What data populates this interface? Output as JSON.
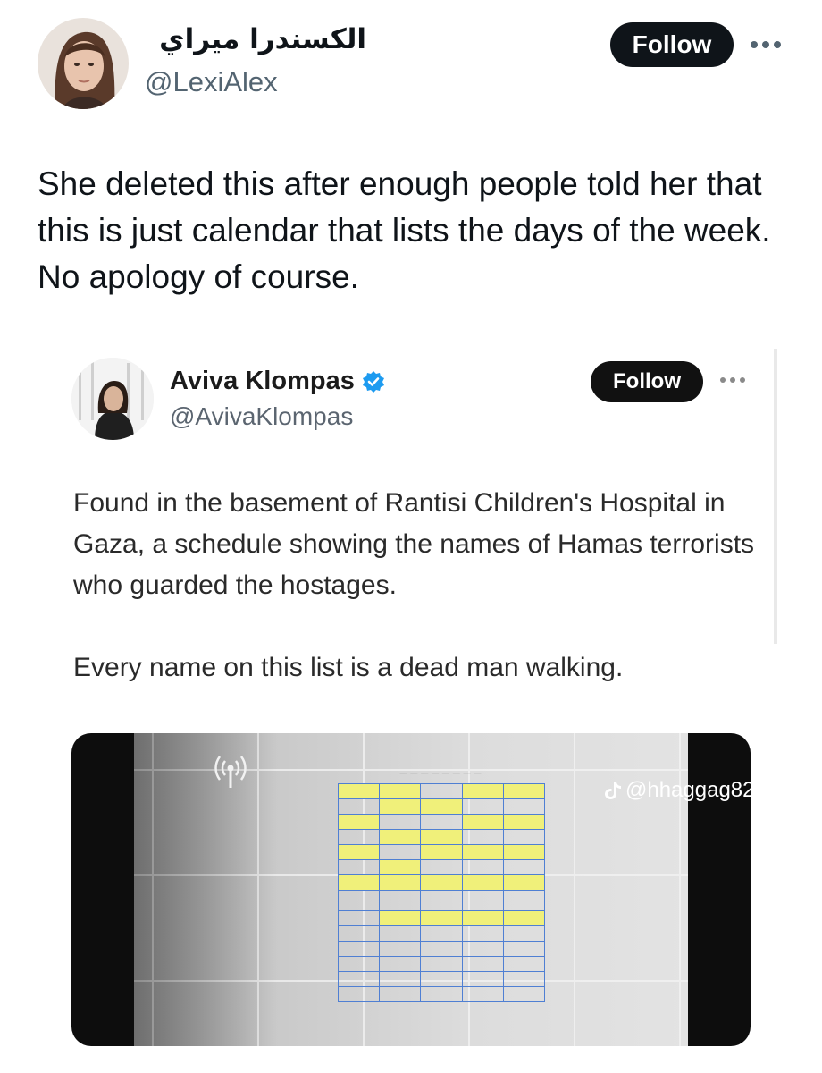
{
  "outer_post": {
    "author_name": "الكسندرا ميراي",
    "author_handle": "@LexiAlex",
    "follow_label": "Follow",
    "more_icon": "more-horizontal-icon",
    "text": "She deleted this after enough people told her that this is just calendar that lists the days of the week. No apology of course."
  },
  "quoted_screenshot": {
    "author_name": "Aviva Klompas",
    "author_handle": "@AvivaKlompas",
    "verified_icon": "verified-badge-icon",
    "verified_color": "#1d9bf0",
    "follow_label": "Follow",
    "more_icon": "more-horizontal-icon",
    "paragraph_1": "Found in the basement of Rantisi Children's Hospital in Gaza, a schedule showing the names of Hamas terrorists who guarded the hostages.",
    "paragraph_2": "Every name on this list is a dead man walking.",
    "media": {
      "watermark": "@hhaggag82",
      "watermark_icon": "tiktok-icon",
      "signal_icon": "broadcast-signal-icon",
      "highlight_color": "#f0f07a",
      "grid_color": "#4f7fd3"
    }
  }
}
